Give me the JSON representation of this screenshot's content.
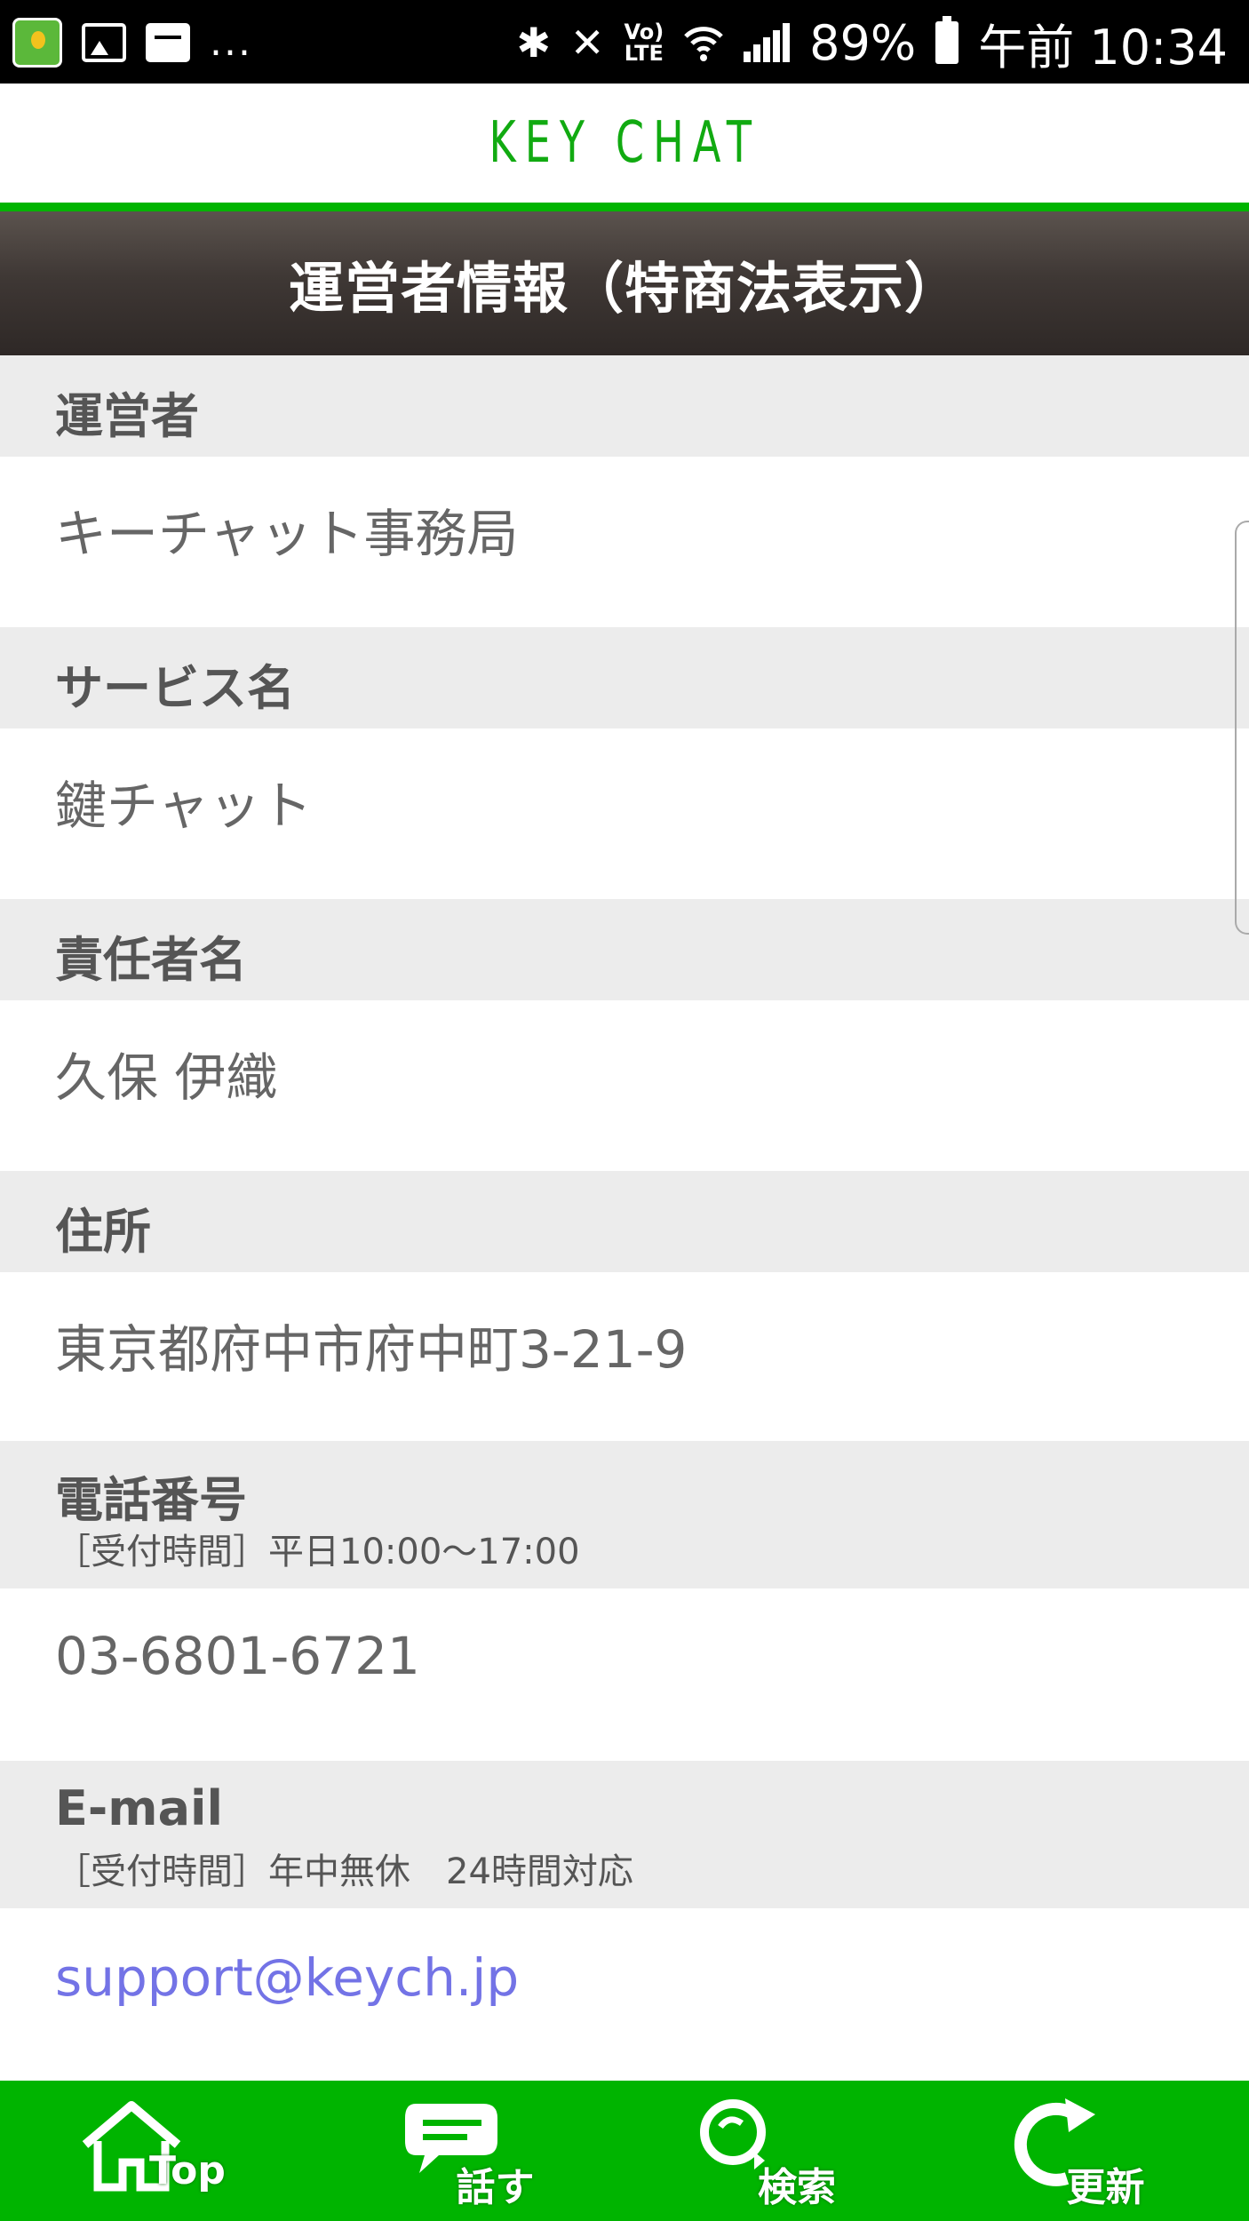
{
  "status_bar": {
    "dots": "...",
    "battery": "89%",
    "time": "午前 10:34",
    "icons": [
      "keychat-app-icon",
      "image-icon",
      "mail-icon",
      "bluetooth-icon",
      "mute-icon",
      "volte-icon",
      "wifi-icon",
      "signal-icon",
      "battery-icon"
    ]
  },
  "header": {
    "logo": "KEY CHAT",
    "title": "運営者情報（特商法表示）"
  },
  "sections": [
    {
      "label": "運営者",
      "sub": "",
      "value": "キーチャット事務局"
    },
    {
      "label": "サービス名",
      "sub": "",
      "value": "鍵チャット"
    },
    {
      "label": "責任者名",
      "sub": "",
      "value": "久保 伊織"
    },
    {
      "label": "住所",
      "sub": "",
      "value": "東京都府中市府中町3-21-9"
    },
    {
      "label": "電話番号",
      "sub": "［受付時間］平日10:00〜17:00",
      "value": "03-6801-6721"
    },
    {
      "label": "E-mail",
      "sub": "［受付時間］年中無休　24時間対応",
      "value": "support@keych.jp"
    }
  ],
  "bottom_nav": [
    {
      "label": "Top",
      "icon": "home-icon"
    },
    {
      "label": "話す",
      "icon": "chat-bubble-icon"
    },
    {
      "label": "検索",
      "icon": "search-icon"
    },
    {
      "label": "更新",
      "icon": "refresh-icon"
    }
  ],
  "colors": {
    "brand_green": "#00b400",
    "link": "#7373e6",
    "section_bg": "#ececec"
  }
}
